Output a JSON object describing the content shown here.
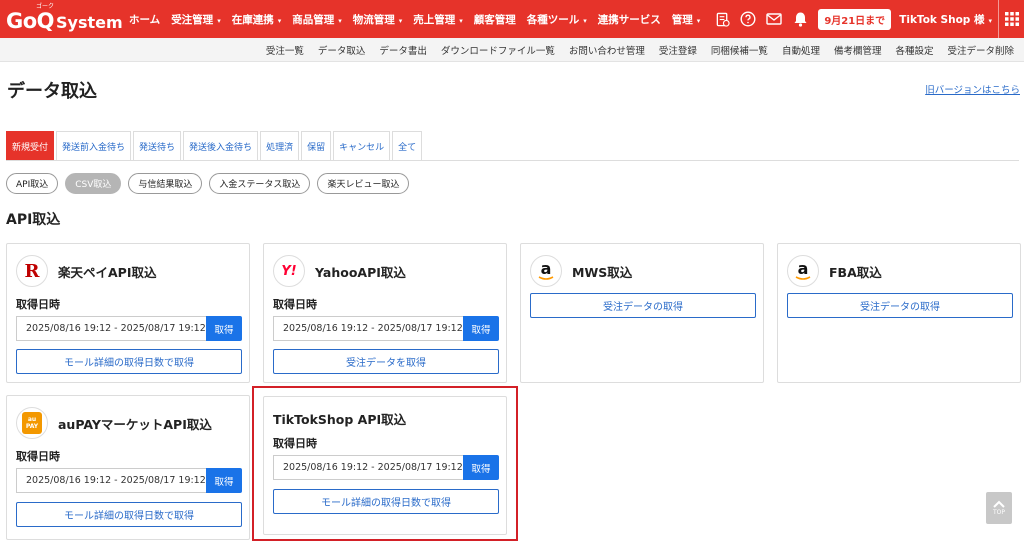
{
  "header": {
    "logo_main": "GoQ",
    "logo_sub": "System",
    "logo_kana": "ゴーク",
    "nav": [
      {
        "label": "ホーム",
        "caret": false
      },
      {
        "label": "受注管理",
        "caret": true
      },
      {
        "label": "在庫連携",
        "caret": true
      },
      {
        "label": "商品管理",
        "caret": true
      },
      {
        "label": "物流管理",
        "caret": true
      },
      {
        "label": "売上管理",
        "caret": true
      },
      {
        "label": "顧客管理",
        "caret": false
      },
      {
        "label": "各種ツール",
        "caret": true
      },
      {
        "label": "連携サービス",
        "caret": false
      },
      {
        "label": "管理",
        "caret": true
      }
    ],
    "icons": [
      "invoice-icon",
      "help-icon",
      "mail-icon",
      "bell-icon"
    ],
    "date_badge": "9月21日まで",
    "user": "TikTok Shop 様",
    "caret": "▾",
    "accent": "#e6332a"
  },
  "subnav": [
    "受注一覧",
    "データ取込",
    "データ書出",
    "ダウンロードファイル一覧",
    "お問い合わせ管理",
    "受注登録",
    "同梱候補一覧",
    "自動処理",
    "備考欄管理",
    "各種設定",
    "受注データ削除"
  ],
  "page_title": "データ取込",
  "old_version_link": "旧バージョンはこちら",
  "tabs": [
    "新規受付",
    "発送前入金待ち",
    "発送待ち",
    "発送後入金待ち",
    "処理済",
    "保留",
    "キャンセル",
    "全て"
  ],
  "pills": [
    "API取込",
    "CSV取込",
    "与信結果取込",
    "入金ステータス取込",
    "楽天レビュー取込"
  ],
  "section_title": "API取込",
  "cards": {
    "rakuten": {
      "title": "楽天ペイAPI取込",
      "label": "取得日時",
      "date_range": "2025/08/16 19:12 - 2025/08/17 19:12",
      "get": "取得",
      "button": "モール詳細の取得日数で取得",
      "icon_letter": "R"
    },
    "yahoo": {
      "title": "YahooAPI取込",
      "label": "取得日時",
      "date_range": "2025/08/16 19:12 - 2025/08/17 19:12",
      "get": "取得",
      "button": "受注データを取得",
      "icon_letter": "Y!"
    },
    "mws": {
      "title": "MWS取込",
      "button": "受注データの取得",
      "icon_letter": "a"
    },
    "fba": {
      "title": "FBA取込",
      "button": "受注データの取得",
      "icon_letter": "a"
    },
    "aupay": {
      "title": "auPAYマーケットAPI取込",
      "label": "取得日時",
      "date_range": "2025/08/16 19:12 - 2025/08/17 19:12",
      "get": "取得",
      "button": "モール詳細の取得日数で取得",
      "icon_line1": "au",
      "icon_line2": "PAY"
    },
    "tiktok": {
      "title": "TikTokShop API取込",
      "label": "取得日時",
      "date_range": "2025/08/16 19:12 - 2025/08/17 19:12",
      "get": "取得",
      "button": "モール詳細の取得日数で取得"
    }
  },
  "top_button": "TOP"
}
